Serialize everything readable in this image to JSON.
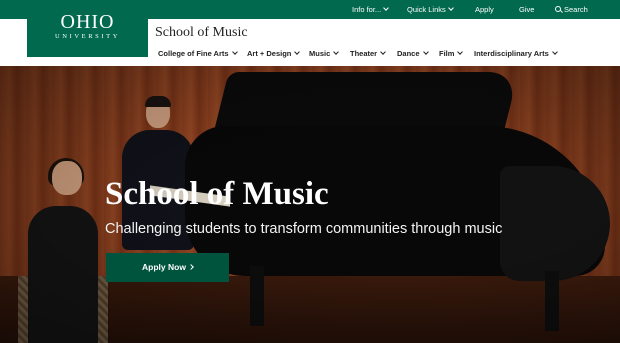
{
  "colors": {
    "brand_green": "#00694e",
    "button_green": "#00533d",
    "nav_text": "#222222"
  },
  "logo": {
    "word": "OHIO",
    "sub": "UNIVERSITY"
  },
  "utility_nav": {
    "items": [
      {
        "label": "Info for...",
        "icon": "chevron-down-icon"
      },
      {
        "label": "Quick Links",
        "icon": "chevron-down-icon"
      },
      {
        "label": "Apply"
      },
      {
        "label": "Give"
      },
      {
        "label": "Search",
        "icon": "search-icon"
      }
    ]
  },
  "header": {
    "title": "School of Music"
  },
  "main_nav": {
    "items": [
      {
        "label": "College of Fine Arts",
        "icon": "chevron-down-icon"
      },
      {
        "label": "Art + Design",
        "icon": "chevron-down-icon"
      },
      {
        "label": "Music",
        "icon": "chevron-down-icon"
      },
      {
        "label": "Theater",
        "icon": "chevron-down-icon"
      },
      {
        "label": "Dance",
        "icon": "chevron-down-icon"
      },
      {
        "label": "Film",
        "icon": "chevron-down-icon"
      },
      {
        "label": "Interdisciplinary Arts",
        "icon": "chevron-down-icon"
      }
    ]
  },
  "hero": {
    "title": "School of Music",
    "subtitle": "Challenging students to transform communities through music",
    "cta_label": "Apply Now",
    "cta_icon": "chevron-right-icon"
  }
}
